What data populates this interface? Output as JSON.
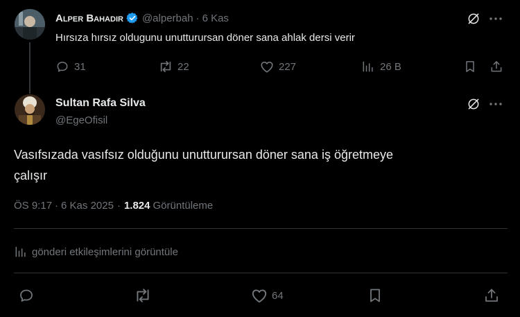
{
  "reply": {
    "author_name": "Alper Bahadır",
    "handle": "@alperbah",
    "separator": "·",
    "time": "6 Kas",
    "text": "Hırsıza hırsız oldugunu unutturursan döner sana ahlak dersi verir",
    "replies": "31",
    "reposts": "22",
    "likes": "227",
    "views": "26 B",
    "verified_color": "#1d9bf0"
  },
  "main": {
    "author_name": "Sultan Rafa Silva",
    "handle": "@EgeOfisil",
    "text_line1": "Vasıfsızada vasıfsız olduğunu unutturursan döner sana iş öğretmeye",
    "text_line2": "çalışır",
    "time": "ÖS 9:17",
    "sep1": "·",
    "date": "6 Kas 2025",
    "sep2": "·",
    "view_count": "1.824",
    "view_label": "Görüntüleme",
    "engagements_link": "gönderi etkileşimlerini görüntüle",
    "likes": "64"
  }
}
